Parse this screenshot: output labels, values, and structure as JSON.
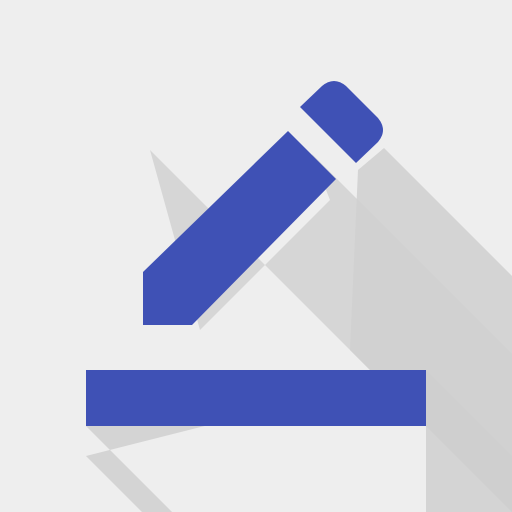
{
  "app": {
    "icon": {
      "name": "edit-underline-icon",
      "background_color": "#EEEEEE",
      "shadow_color": "#CFCFCF",
      "accent_color": "#3F51B5",
      "accent_shade_color": "#3A4CB0"
    }
  }
}
